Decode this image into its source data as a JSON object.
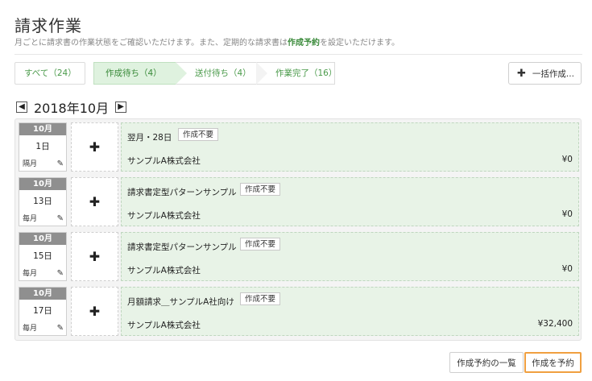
{
  "page": {
    "title": "請求作業",
    "subtitle_pre": "月ごとに請求書の作業状態をご確認いただけます。また、定期的な請求書は",
    "subtitle_link": "作成予約",
    "subtitle_post": "を設定いただけます。"
  },
  "tabs": [
    {
      "label": "すべて（24）"
    },
    {
      "label": "作成待ち（4）"
    },
    {
      "label": "送付待ち（4）"
    },
    {
      "label": "作業完了（16）"
    }
  ],
  "bulk_button": {
    "label": "一括作成..."
  },
  "month_nav": {
    "label": "2018年10月",
    "prev": "◀",
    "next": "▶"
  },
  "rows": [
    {
      "month": "10月",
      "day": "1日",
      "freq": "隔月",
      "name": "翌月・28日",
      "badge": "作成不要",
      "company": "サンプルA株式会社",
      "amount": "¥0"
    },
    {
      "month": "10月",
      "day": "13日",
      "freq": "毎月",
      "name": "請求書定型パターンサンプル",
      "badge": "作成不要",
      "company": "サンプルA株式会社",
      "amount": "¥0"
    },
    {
      "month": "10月",
      "day": "15日",
      "freq": "毎月",
      "name": "請求書定型パターンサンプル",
      "badge": "作成不要",
      "company": "サンプルA株式会社",
      "amount": "¥0"
    },
    {
      "month": "10月",
      "day": "17日",
      "freq": "毎月",
      "name": "月額請求＿サンプルA社向け",
      "badge": "作成不要",
      "company": "サンプルA株式会社",
      "amount": "¥32,400"
    }
  ],
  "footer": {
    "list_label": "作成予約の一覧",
    "schedule_label": "作成を予約"
  },
  "icons": {
    "plus": "plus-icon",
    "pencil": "pencil-icon",
    "prev": "arrow-left-icon",
    "next": "arrow-right-icon"
  },
  "colors": {
    "accent_green": "#3a8a3a",
    "active_tab_bg": "#dff2df",
    "card_bg": "#e8f3e7",
    "highlight_orange": "#f0a040"
  }
}
